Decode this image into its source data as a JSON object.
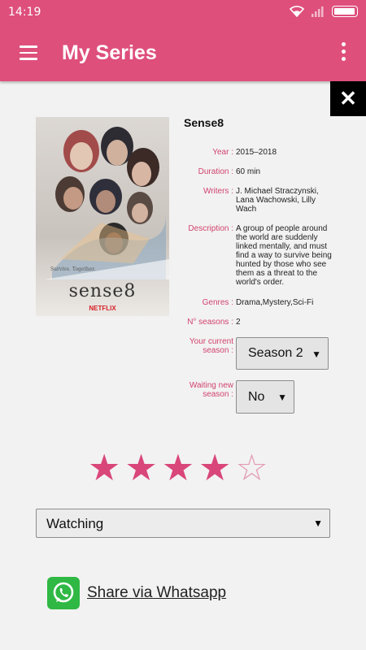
{
  "status_bar": {
    "time": "14:19"
  },
  "app_bar": {
    "title": "My Series"
  },
  "close": {
    "symbol": "✕"
  },
  "poster": {
    "title_text": "sense8",
    "tagline": "Survive. Together.",
    "brand": "NETFLIX"
  },
  "series": {
    "title": "Sense8",
    "fields": {
      "year": {
        "label": "Year :",
        "value": "2015–2018"
      },
      "duration": {
        "label": "Duration :",
        "value": "60 min"
      },
      "writers": {
        "label": "Writers :",
        "value": "J. Michael Straczynski, Lana Wachowski, Lilly Wach"
      },
      "description": {
        "label": "Description :",
        "value": "A group of people around the world are suddenly linked mentally, and must find a way to survive being hunted by those who see them as a threat to the world's order."
      },
      "genres": {
        "label": "Genres :",
        "value": "Drama,Mystery,Sci-Fi"
      },
      "seasons": {
        "label": "N° seasons :",
        "value": "2"
      }
    },
    "current_season": {
      "label": "Your current season :",
      "value": "Season 2"
    },
    "waiting_new_season": {
      "label": "Waiting new season :",
      "value": "No"
    }
  },
  "rating": {
    "value": 4,
    "max": 5,
    "star_full": "★",
    "star_empty": "☆"
  },
  "watch_status": {
    "value": "Watching"
  },
  "share": {
    "label": "Share via Whatsapp"
  },
  "colors": {
    "accent": "#de4f7c",
    "star": "#d9467a",
    "whatsapp": "#2fb844"
  }
}
